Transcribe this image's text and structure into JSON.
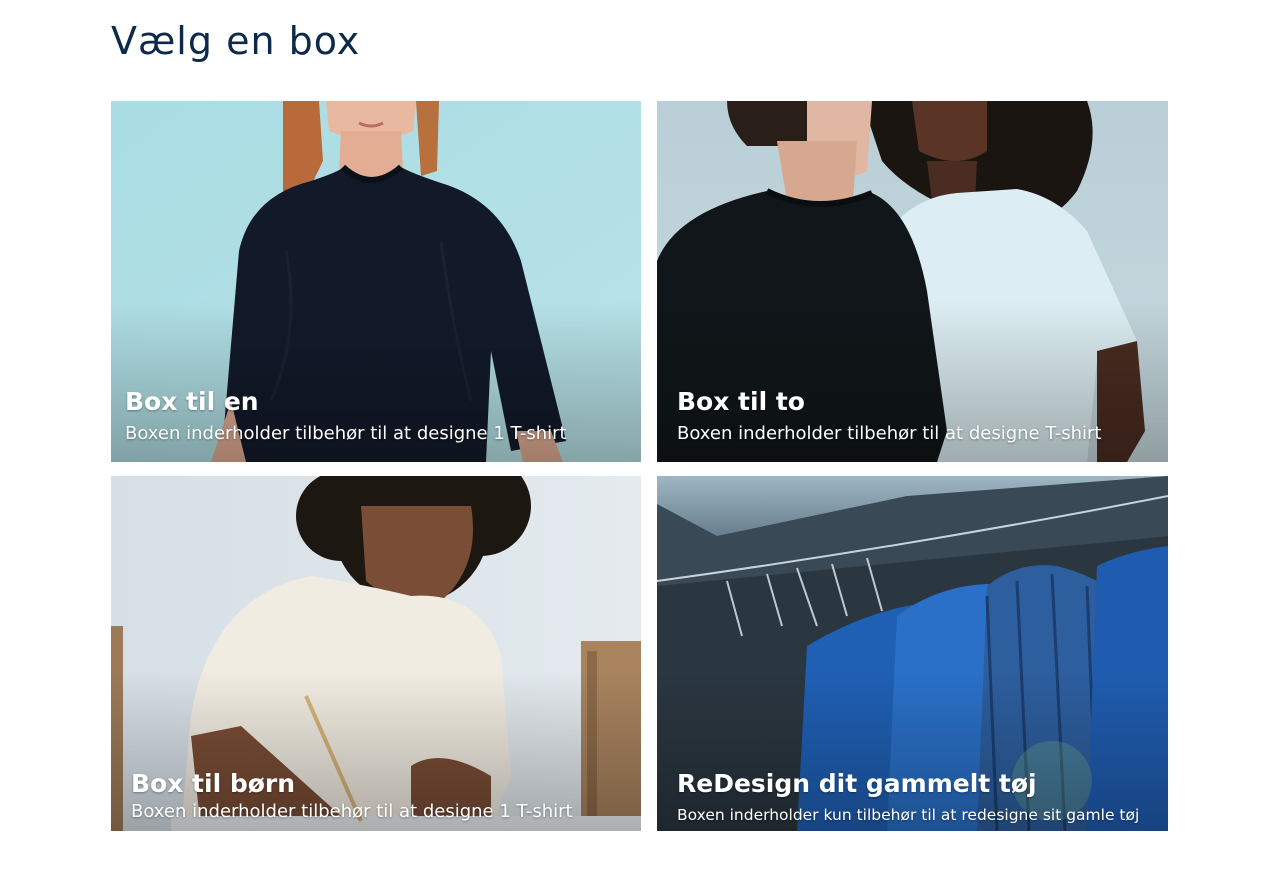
{
  "page": {
    "heading": "Vælg en box"
  },
  "boxes": [
    {
      "title": "Box til en",
      "description": "Boxen inderholder tilbehør til at designe 1 T-shirt",
      "selected": true,
      "image": "woman-black-tshirt-photo"
    },
    {
      "title": "Box til to",
      "description": "Boxen inderholder tilbehør til at designe T-shirt",
      "selected": false,
      "image": "couple-tshirts-photo"
    },
    {
      "title": "Box til børn",
      "description": "Boxen inderholder tilbehør til at designe 1 T-shirt",
      "selected": false,
      "image": "child-drawing-photo"
    },
    {
      "title": "ReDesign dit gammelt tøj",
      "description": "Boxen inderholder kun tilbehør til at redesigne sit gamle tøj",
      "selected": false,
      "image": "blue-shirts-on-line-photo"
    }
  ],
  "colors": {
    "heading": "#0d2a4a",
    "selected_border": "#2f8fe0",
    "card_text": "#ffffff"
  }
}
